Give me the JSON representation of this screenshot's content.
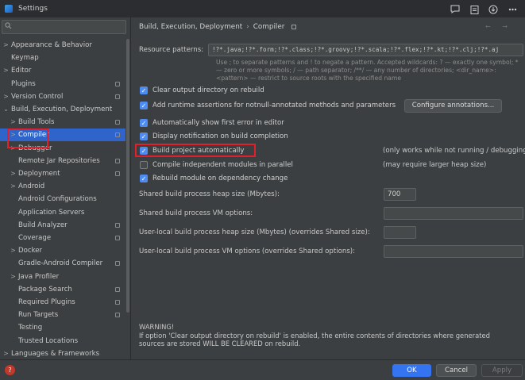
{
  "window": {
    "title": "Settings"
  },
  "search": {
    "placeholder": ""
  },
  "sidebar": {
    "items": [
      {
        "label": "Appearance & Behavior",
        "arrow": ">",
        "indent": 0
      },
      {
        "label": "Keymap",
        "arrow": "",
        "indent": 0
      },
      {
        "label": "Editor",
        "arrow": ">",
        "indent": 0
      },
      {
        "label": "Plugins",
        "arrow": "",
        "indent": 0,
        "badge": true
      },
      {
        "label": "Version Control",
        "arrow": ">",
        "indent": 0,
        "badge": true
      },
      {
        "label": "Build, Execution, Deployment",
        "arrow": "⌄",
        "indent": 0
      },
      {
        "label": "Build Tools",
        "arrow": ">",
        "indent": 1,
        "badge": true
      },
      {
        "label": "Compiler",
        "arrow": ">",
        "indent": 1,
        "badge": true,
        "selected": true
      },
      {
        "label": "Debugger",
        "arrow": ">",
        "indent": 1
      },
      {
        "label": "Remote Jar Repositories",
        "arrow": "",
        "indent": 1,
        "badge": true
      },
      {
        "label": "Deployment",
        "arrow": ">",
        "indent": 1,
        "badge": true
      },
      {
        "label": "Android",
        "arrow": ">",
        "indent": 1
      },
      {
        "label": "Android Configurations",
        "arrow": "",
        "indent": 1
      },
      {
        "label": "Application Servers",
        "arrow": "",
        "indent": 1
      },
      {
        "label": "Build Analyzer",
        "arrow": "",
        "indent": 1,
        "badge": true
      },
      {
        "label": "Coverage",
        "arrow": "",
        "indent": 1,
        "badge": true
      },
      {
        "label": "Docker",
        "arrow": ">",
        "indent": 1
      },
      {
        "label": "Gradle-Android Compiler",
        "arrow": "",
        "indent": 1,
        "badge": true
      },
      {
        "label": "Java Profiler",
        "arrow": ">",
        "indent": 1
      },
      {
        "label": "Package Search",
        "arrow": "",
        "indent": 1,
        "badge": true
      },
      {
        "label": "Required Plugins",
        "arrow": "",
        "indent": 1,
        "badge": true
      },
      {
        "label": "Run Targets",
        "arrow": "",
        "indent": 1,
        "badge": true
      },
      {
        "label": "Testing",
        "arrow": "",
        "indent": 1
      },
      {
        "label": "Trusted Locations",
        "arrow": "",
        "indent": 1
      },
      {
        "label": "Languages & Frameworks",
        "arrow": ">",
        "indent": 0
      }
    ]
  },
  "breadcrumb": {
    "parent": "Build, Execution, Deployment",
    "separator": "›",
    "current": "Compiler"
  },
  "resource": {
    "label": "Resource patterns:",
    "value": "!?*.java;!?*.form;!?*.class;!?*.groovy;!?*.scala;!?*.flex;!?*.kt;!?*.clj;!?*.aj",
    "hint_line1": "Use ; to separate patterns and ! to negate a pattern. Accepted wildcards: ? — exactly one symbol; *",
    "hint_line2": "— zero or more symbols; / — path separator; /**/ — any number of directories; <dir_name>:",
    "hint_line3": "<pattern> — restrict to source roots with the specified name"
  },
  "options": {
    "clear_output": {
      "label": "Clear output directory on rebuild",
      "checked": true
    },
    "runtime_assertions": {
      "label": "Add runtime assertions for notnull-annotated methods and parameters",
      "checked": true
    },
    "show_first_error": {
      "label": "Automatically show first error in editor",
      "checked": true
    },
    "notify_completion": {
      "label": "Display notification on build completion",
      "checked": true
    },
    "build_auto": {
      "label": "Build project automatically",
      "checked": true,
      "note": "(only works while not running / debugging)"
    },
    "compile_parallel": {
      "label": "Compile independent modules in parallel",
      "checked": false,
      "note": "(may require larger heap size)"
    },
    "rebuild_module": {
      "label": "Rebuild module on dependency change",
      "checked": true
    }
  },
  "configure_button": {
    "label": "Configure annotations..."
  },
  "fields": {
    "shared_heap": {
      "label": "Shared build process heap size (Mbytes):",
      "value": "700"
    },
    "shared_vm": {
      "label": "Shared build process VM options:",
      "value": ""
    },
    "user_heap": {
      "label": "User-local build process heap size (Mbytes) (overrides Shared size):",
      "value": ""
    },
    "user_vm": {
      "label": "User-local build process VM options (overrides Shared options):",
      "value": ""
    }
  },
  "warning": {
    "title": "WARNING!",
    "line1": "If option 'Clear output directory on rebuild' is enabled, the entire contents of directories where generated",
    "line2": "sources are stored WILL BE CLEARED on rebuild."
  },
  "footer": {
    "ok": "OK",
    "cancel": "Cancel",
    "apply": "Apply"
  },
  "colors": {
    "accent": "#2f65ca",
    "checkbox": "#4e8cf2",
    "highlight": "#e0202a",
    "ok": "#3574f0"
  }
}
